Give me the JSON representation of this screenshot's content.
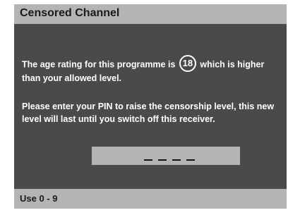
{
  "dialog": {
    "title": "Censored Channel",
    "rating_text_before": "The age rating for this programme is",
    "rating_value": "18",
    "rating_text_after": "which is higher than your allowed level.",
    "instruction": "Please enter your PIN to raise the censorship level, this new level will last until you switch off this receiver.",
    "pin_placeholder_slots": 4,
    "footer_hint": "Use 0 - 9"
  },
  "colors": {
    "panel_bg": "#4a4a4a",
    "bar_bg": "#b4b4b4",
    "text_light": "#ffffff",
    "text_dark": "#1a1a1a"
  }
}
